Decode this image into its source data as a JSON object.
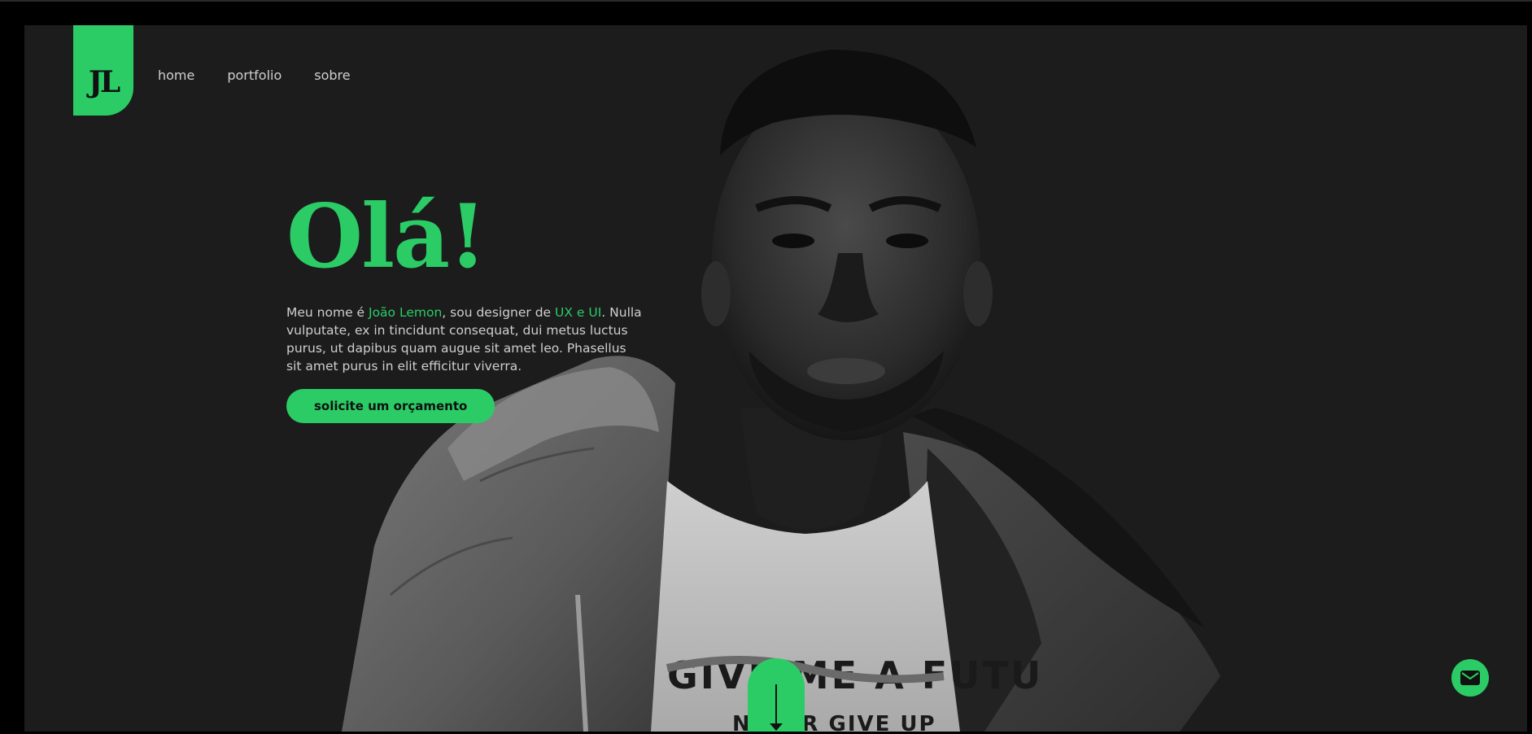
{
  "logo": {
    "text": "JL"
  },
  "nav": {
    "items": [
      {
        "label": "home"
      },
      {
        "label": "portfolio"
      },
      {
        "label": "sobre"
      }
    ]
  },
  "hero": {
    "title": "Olá!",
    "intro_prefix": "Meu nome é ",
    "name": "João Lemon",
    "intro_mid": ", sou designer de ",
    "role": "UX e UI",
    "intro_suffix": ". Nulla vulputate, ex in tincidunt consequat, dui metus luctus purus, ut dapibus quam augue sit amet leo. Phasellus sit amet purus in elit efficitur viverra.",
    "cta_label": "solicite um orçamento"
  },
  "shirt_text": {
    "line1": "GIVE ME A FUTU",
    "line2": "NEVER GIVE UP"
  },
  "icons": {
    "scroll": "arrow-down-icon",
    "mail": "mail-icon"
  },
  "colors": {
    "accent": "#2bcc66",
    "background": "#1c1c1d",
    "text": "#cfcfcf"
  }
}
